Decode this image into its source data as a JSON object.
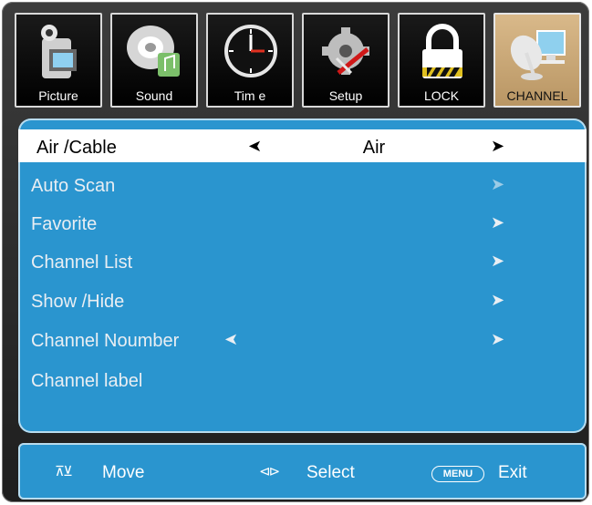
{
  "tabs": [
    {
      "label": "Picture",
      "icon": "camera-icon"
    },
    {
      "label": "Sound",
      "icon": "speaker-music-icon"
    },
    {
      "label": "Tim e",
      "icon": "clock-icon"
    },
    {
      "label": "Setup",
      "icon": "gear-tools-icon"
    },
    {
      "label": "LOCK",
      "icon": "padlock-icon"
    },
    {
      "label": "CHANNEL",
      "icon": "satellite-dish-icon"
    }
  ],
  "active_tab": "CHANNEL",
  "colors": {
    "menu_bg": "#2a95cf",
    "active_tab": "#c9a574",
    "frame": "#2b2b2b"
  },
  "menu": {
    "air_cable": {
      "label": "Air /Cable",
      "value": "Air"
    },
    "items": [
      {
        "label": "Auto  Scan"
      },
      {
        "label": "Favorite"
      },
      {
        "label": "Channel List"
      },
      {
        "label": "Show /Hide"
      },
      {
        "label": "Channel Noumber"
      },
      {
        "label": "Channel label"
      }
    ]
  },
  "footer": {
    "move": "Move",
    "select": "Select",
    "menu_key": "MENU",
    "exit": "Exit"
  }
}
